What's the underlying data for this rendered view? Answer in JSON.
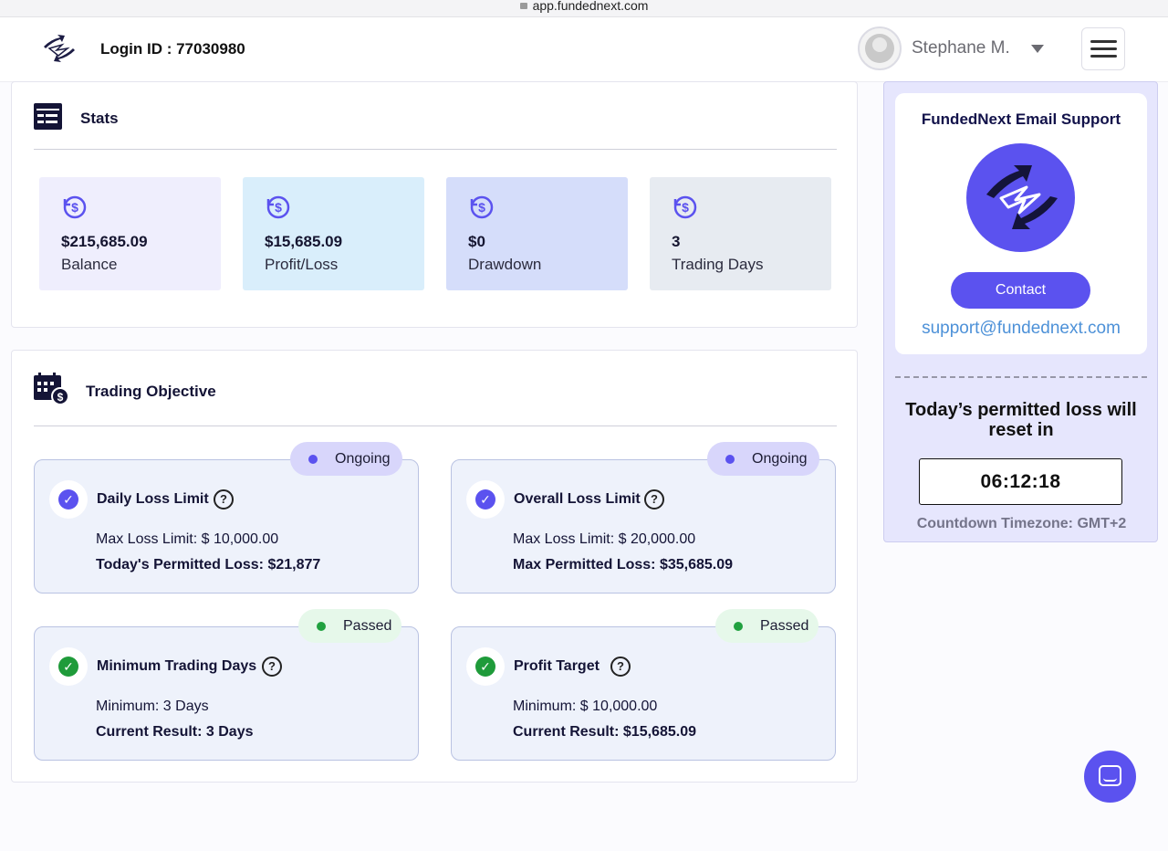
{
  "browser": {
    "url": "app.fundednext.com"
  },
  "header": {
    "login_id": "Login ID : 77030980",
    "user_name": "Stephane M."
  },
  "stats": {
    "title": "Stats",
    "items": [
      {
        "value": "$215,685.09",
        "label": "Balance",
        "bg": "#efeefd"
      },
      {
        "value": "$15,685.09",
        "label": "Profit/Loss",
        "bg": "#d9eefb"
      },
      {
        "value": "$0",
        "label": "Drawdown",
        "bg": "#d5ddfa"
      },
      {
        "value": "3",
        "label": "Trading Days",
        "bg": "#e7ebf1"
      }
    ]
  },
  "objective": {
    "title": "Trading Objective",
    "items": [
      {
        "title": "Daily Loss Limit",
        "status": "Ongoing",
        "line1_label": "Max Loss Limit:",
        "line1_value": "$ 10,000.00",
        "line2_label": "Today's Permitted Loss:",
        "line2_value": "$21,877"
      },
      {
        "title": "Overall Loss Limit",
        "status": "Ongoing",
        "line1_label": "Max Loss Limit:",
        "line1_value": "$ 20,000.00",
        "line2_label": "Max Permitted Loss:",
        "line2_value": "$35,685.09"
      },
      {
        "title": "Minimum Trading Days",
        "status": "Passed",
        "line1_label": "Minimum:",
        "line1_value": "3 Days",
        "line2_label": "Current Result:",
        "line2_value": "3 Days"
      },
      {
        "title": "Profit Target",
        "status": "Passed",
        "line1_label": "Minimum:",
        "line1_value": "$ 10,000.00",
        "line2_label": "Current Result:",
        "line2_value": "$15,685.09"
      }
    ]
  },
  "support": {
    "title": "FundedNext Email Support",
    "contact_label": "Contact",
    "email": "support@fundednext.com",
    "reset_text": "Today’s permitted loss will reset in",
    "countdown": "06:12:18",
    "timezone": "Countdown Timezone: GMT+2"
  },
  "colors": {
    "accent": "#5b52ef",
    "ongoing_badge": "#d8d6fb",
    "ongoing_dot": "#5b52ef",
    "passed_badge": "#e6f8ea",
    "passed_dot": "#21a140",
    "check_ongoing": "#5b52ef",
    "check_passed": "#1f9b3a"
  }
}
